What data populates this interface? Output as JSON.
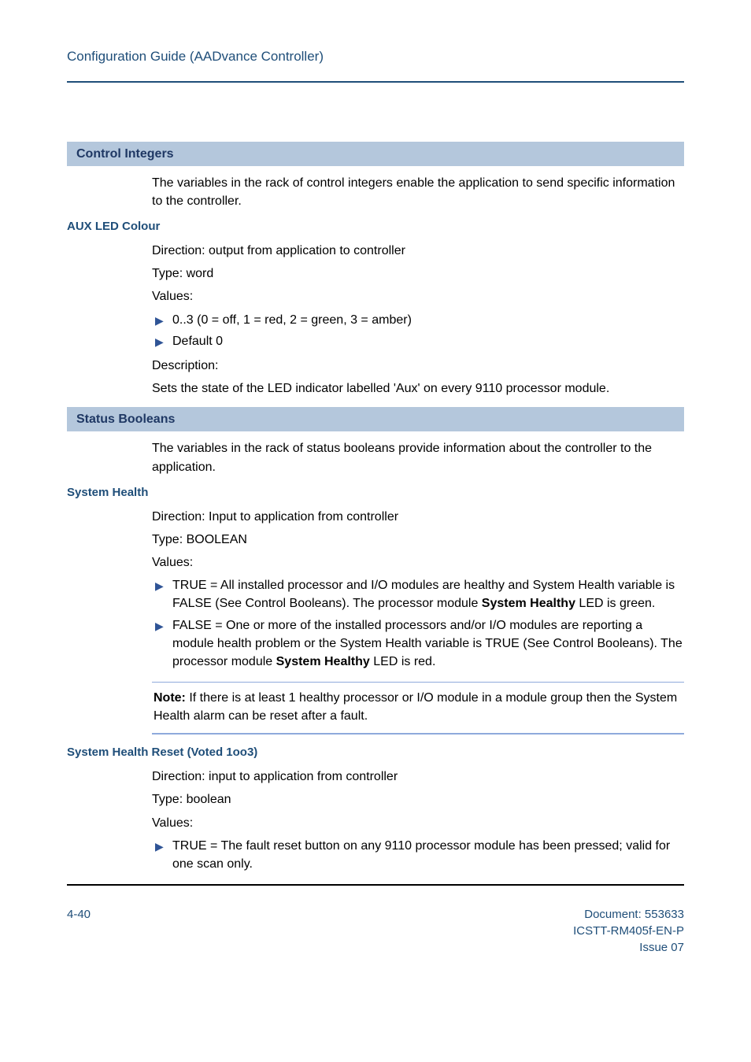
{
  "header": {
    "title": "Configuration Guide (AADvance Controller)"
  },
  "sections": {
    "control_integers": {
      "banner": "Control Integers",
      "intro": "The variables in the rack of control integers enable the application to send specific information to the controller.",
      "aux_led": {
        "heading": "AUX LED Colour",
        "direction": "Direction: output from application to controller",
        "type": "Type: word",
        "values_label": "Values:",
        "bullets": [
          "0..3 (0 = off, 1 = red, 2 = green, 3 = amber)",
          "Default 0"
        ],
        "desc_label": "Description:",
        "desc_text": "Sets the state of the LED indicator labelled 'Aux' on every 9110 processor module."
      }
    },
    "status_booleans": {
      "banner": "Status Booleans",
      "intro": "The variables in the rack of status booleans provide information about the controller to the application.",
      "system_health": {
        "heading": "System Health",
        "direction": "Direction: Input to application from controller",
        "type": "Type: BOOLEAN",
        "values_label": "Values:",
        "bullet_true_a": "TRUE = All installed processor and I/O modules are healthy and System Health variable is FALSE (See Control Booleans). The processor module ",
        "bullet_true_bold": "System Healthy",
        "bullet_true_b": " LED is green.",
        "bullet_false_a": "FALSE = One or more of the installed processors and/or I/O modules are reporting a module health problem or the System Health variable is TRUE (See Control Booleans). The processor module ",
        "bullet_false_bold": "System Healthy",
        "bullet_false_b": " LED is red.",
        "note_bold": "Note:",
        "note_text": " If there is at least 1 healthy processor or I/O module in a module group then the System Health alarm can be reset after a fault."
      },
      "system_health_reset": {
        "heading": "System Health Reset (Voted 1oo3)",
        "direction": "Direction: input to application from controller",
        "type": "Type: boolean",
        "values_label": "Values:",
        "bullet": "TRUE = The fault reset button on any 9110 processor module has been pressed; valid for one scan only."
      }
    }
  },
  "footer": {
    "page": "4-40",
    "doc": "Document: 553633",
    "code": "ICSTT-RM405f-EN-P",
    "issue": "Issue 07"
  }
}
